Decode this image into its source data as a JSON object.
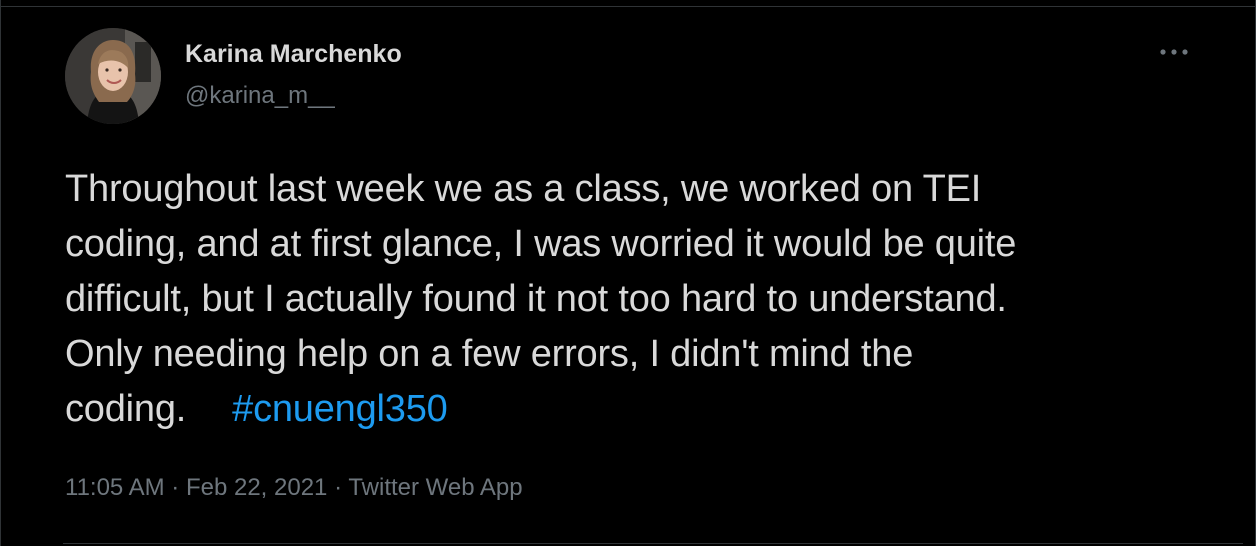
{
  "tweet": {
    "author": {
      "name": "Karina Marchenko",
      "handle": "@karina_m__"
    },
    "text_lines": [
      "Throughout last week we as a class, we worked on TEI",
      "coding, and at first glance, I was worried it would be quite",
      "difficult, but I actually found it not too hard to understand.",
      "Only needing help on a few errors, I didn't mind the",
      "coding."
    ],
    "hashtag": "#cnuengl350",
    "time": "11:05 AM",
    "separator": " · ",
    "date": "Feb 22, 2021",
    "source": "Twitter Web App",
    "more_icon": "more-horizontal-icon"
  },
  "colors": {
    "background": "#000000",
    "text": "#d9d9d9",
    "secondary": "#6e767d",
    "link": "#1d9bf0",
    "border": "#2f3336"
  }
}
